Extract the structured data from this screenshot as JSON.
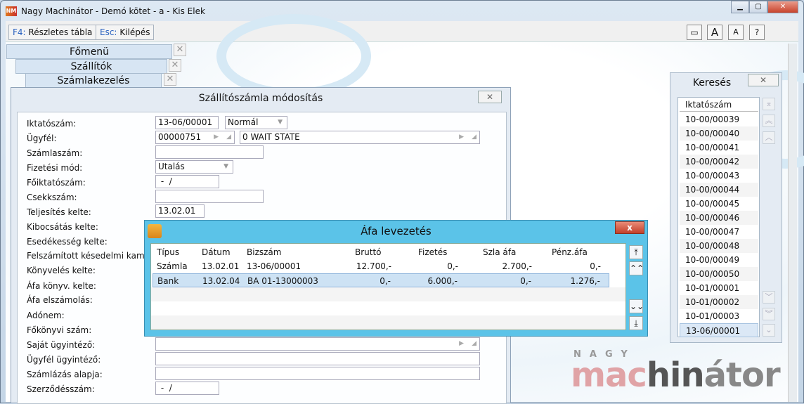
{
  "window": {
    "title": "Nagy Machinátor - Demó kötet - a - Kis Elek",
    "app_icon": "NM",
    "min": "▁",
    "max": "▢",
    "close": "✕"
  },
  "toolbar": {
    "f4_key": "F4:",
    "f4_label": "Részletes tábla",
    "esc_key": "Esc:",
    "esc_label": "Kilépés",
    "right_buttons": [
      "▭",
      "A",
      "A",
      "?"
    ]
  },
  "tabs": [
    {
      "label": "Főmenü"
    },
    {
      "label": "Szállítók"
    },
    {
      "label": "Számlakezelés"
    }
  ],
  "close_glyph": "✕",
  "dialog": {
    "title": "Szállítószámla módosítás",
    "close": "✕",
    "labels": [
      "Iktatószám:",
      "Ügyfél:",
      "Számlaszám:",
      "Fizetési mód:",
      "Főiktatószám:",
      "Csekkszám:",
      "Teljesítés kelte:",
      "Kibocsátás kelte:",
      "Esedékesség kelte:",
      "Felszámított késedelmi kamat",
      "Könyvelés kelte:",
      "Áfa könyv. kelte:",
      "Áfa elszámolás:",
      "Adónem:",
      "Főkönyvi szám:",
      "Saját ügyintéző:",
      "Ügyfél ügyintéző:",
      "Számlázás alapja:",
      "Szerződésszám:"
    ],
    "iktatoszam": "13-06/00001",
    "tipus": "Normál",
    "ugyfel_kod": "00000751",
    "ugyfel_nev": "0 WAIT STATE",
    "fizetesi_mod": "Utalás",
    "foiktatoszam": " -  /",
    "teljesites": "13.02.01",
    "szerzodesszam": " -  /"
  },
  "afa": {
    "title": "Áfa levezetés",
    "close": "x",
    "columns": [
      "Típus",
      "Dátum",
      "Bizszám",
      "Bruttó",
      "Fizetés",
      "Szla áfa",
      "Pénz.áfa"
    ],
    "rows": [
      [
        "Számla",
        "13.02.01",
        "13-06/00001",
        "12.700,-",
        "0,-",
        "2.700,-",
        "0,-"
      ],
      [
        "Bank",
        "13.02.04",
        "BA 01-13000003",
        "0,-",
        "6.000,-",
        "0,-",
        "1.276,-"
      ]
    ],
    "scroll": [
      "⤒",
      "⌃⌃",
      "⌄⌄",
      "⤓"
    ]
  },
  "kereses": {
    "title": "Keresés",
    "close": "✕",
    "column": "Iktatószám",
    "items": [
      "10-00/00039",
      "10-00/00040",
      "10-00/00041",
      "10-00/00042",
      "10-00/00043",
      "10-00/00044",
      "10-00/00045",
      "10-00/00046",
      "10-00/00047",
      "10-00/00048",
      "10-00/00049",
      "10-00/00050",
      "10-01/00001",
      "10-01/00002",
      "10-01/00003",
      "13-06/00001"
    ]
  },
  "logo": {
    "top": "NAGY",
    "a": "mac",
    "b": "hin",
    "c": "átor"
  }
}
